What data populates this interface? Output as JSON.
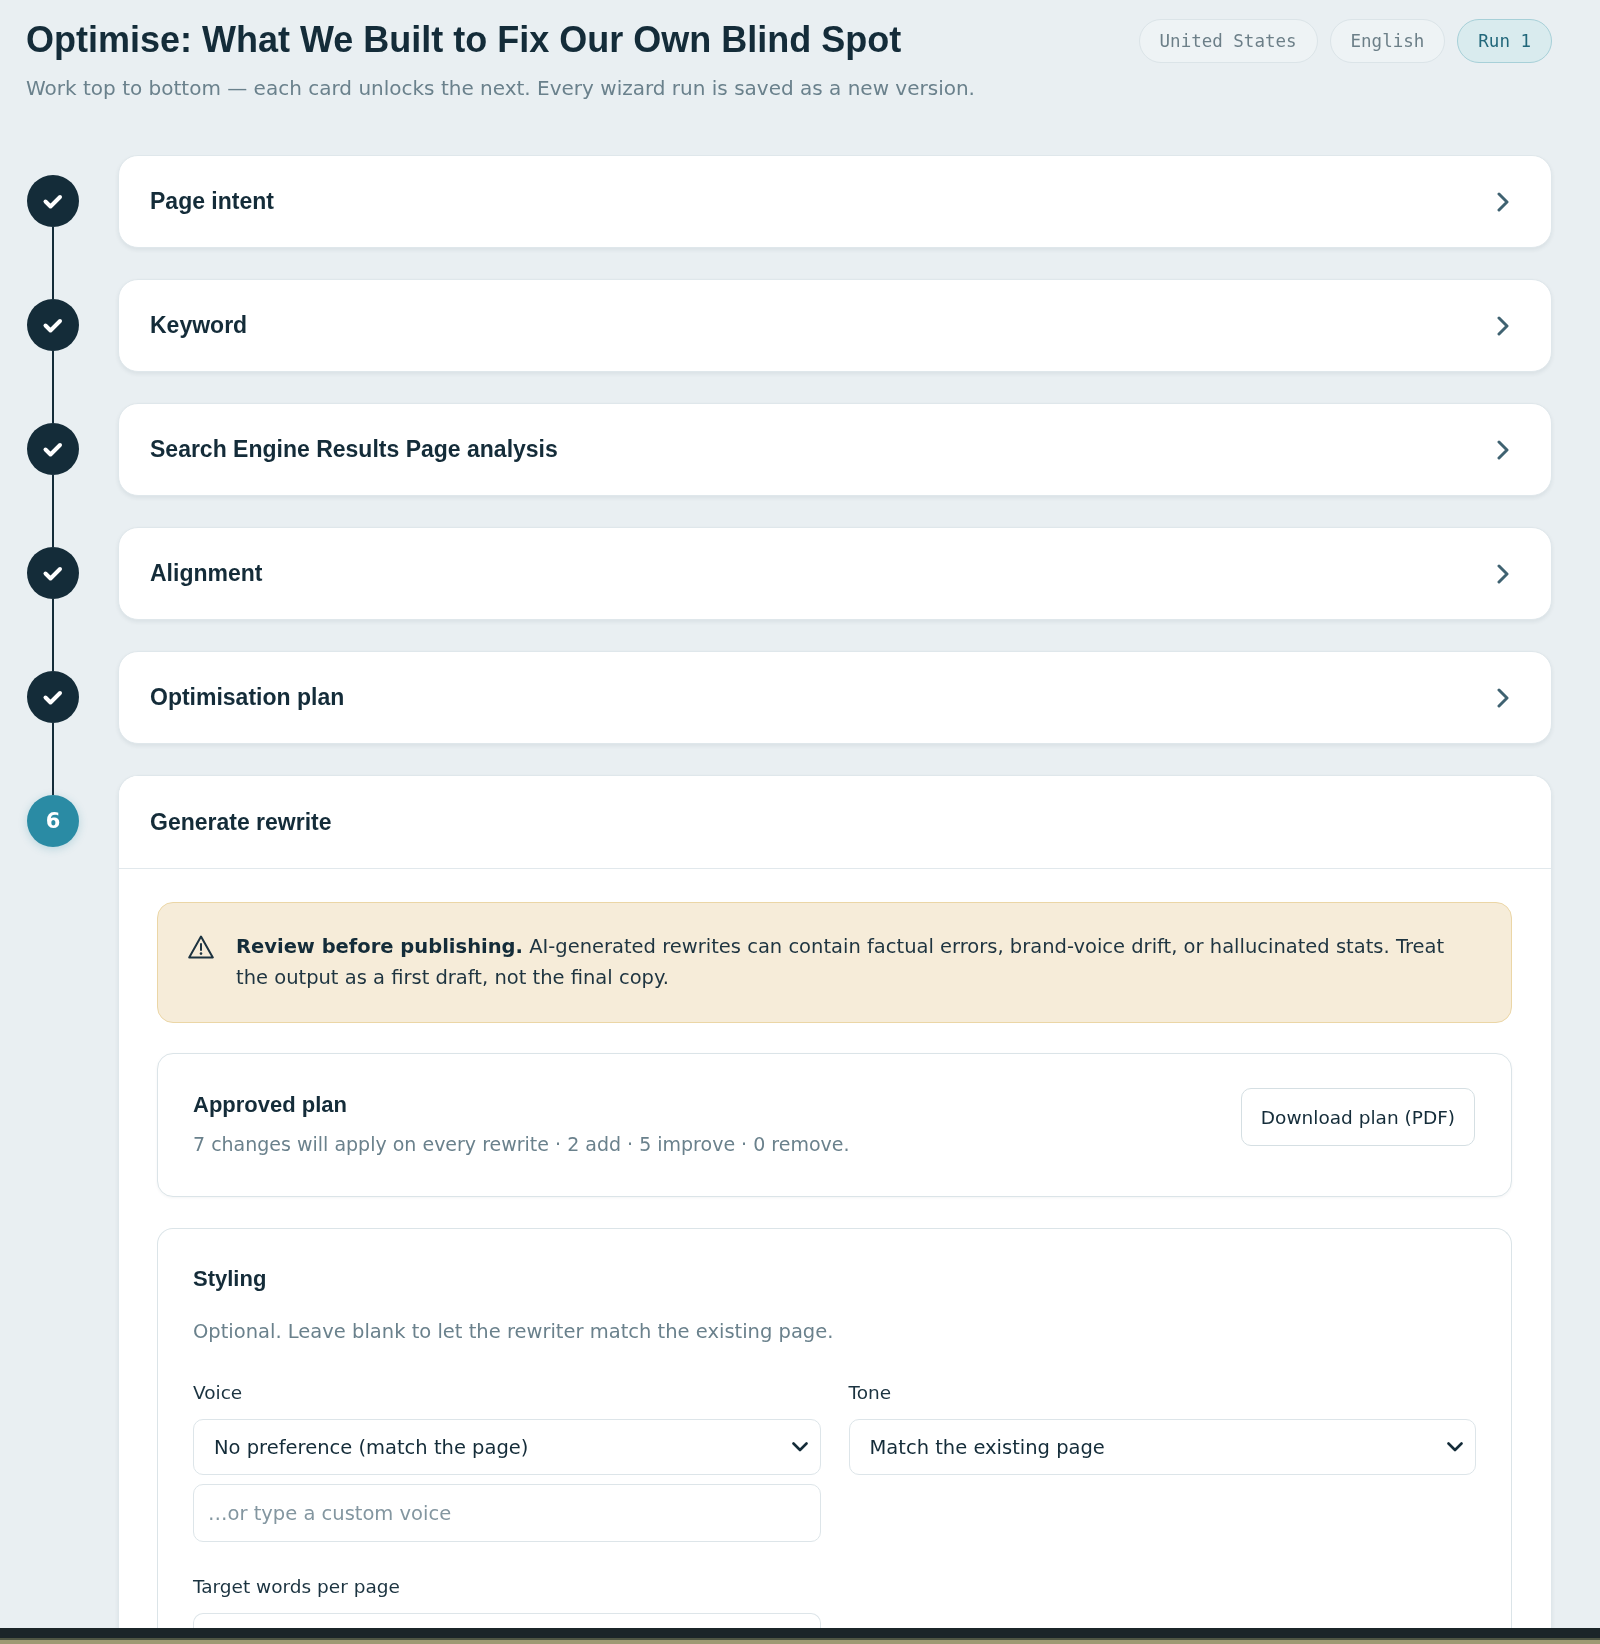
{
  "header": {
    "title": "Optimise: What We Built to Fix Our Own Blind Spot",
    "subtitle": "Work top to bottom — each card unlocks the next. Every wizard run is saved as a new version.",
    "chips": [
      {
        "label": "United States",
        "kind": "meta"
      },
      {
        "label": "English",
        "kind": "meta"
      },
      {
        "label": "Run 1",
        "kind": "run"
      }
    ]
  },
  "steps": [
    {
      "title": "Page intent",
      "done": true,
      "expanded": false
    },
    {
      "title": "Keyword",
      "done": true,
      "expanded": false
    },
    {
      "title": "Search Engine Results Page analysis",
      "done": true,
      "expanded": false
    },
    {
      "title": "Alignment",
      "done": true,
      "expanded": false
    },
    {
      "title": "Optimisation plan",
      "done": true,
      "expanded": false
    },
    {
      "title": "Generate rewrite",
      "done": false,
      "number": "6",
      "expanded": true,
      "content": {
        "warning": "**Review before publishing.** AI-generated rewrites can contain factual errors, brand-voice drift, or hallucinated stats. Treat the output as a first draft, not the final copy.",
        "approved_plan": {
          "title": "Approved plan",
          "summary": "7 changes will apply on every rewrite · 2 add · 5 improve · 0 remove.",
          "button": "Download plan (PDF)"
        },
        "styling": {
          "title": "Styling",
          "description": "Optional. Leave blank to let the rewriter match the existing page.",
          "voice": {
            "label": "Voice",
            "value": "No preference (match the page)",
            "placeholder": "…or type a custom voice"
          },
          "tone": {
            "label": "Tone",
            "value": "Match the existing page"
          },
          "target_words": {
            "label": "Target words per page"
          }
        }
      }
    }
  ]
}
